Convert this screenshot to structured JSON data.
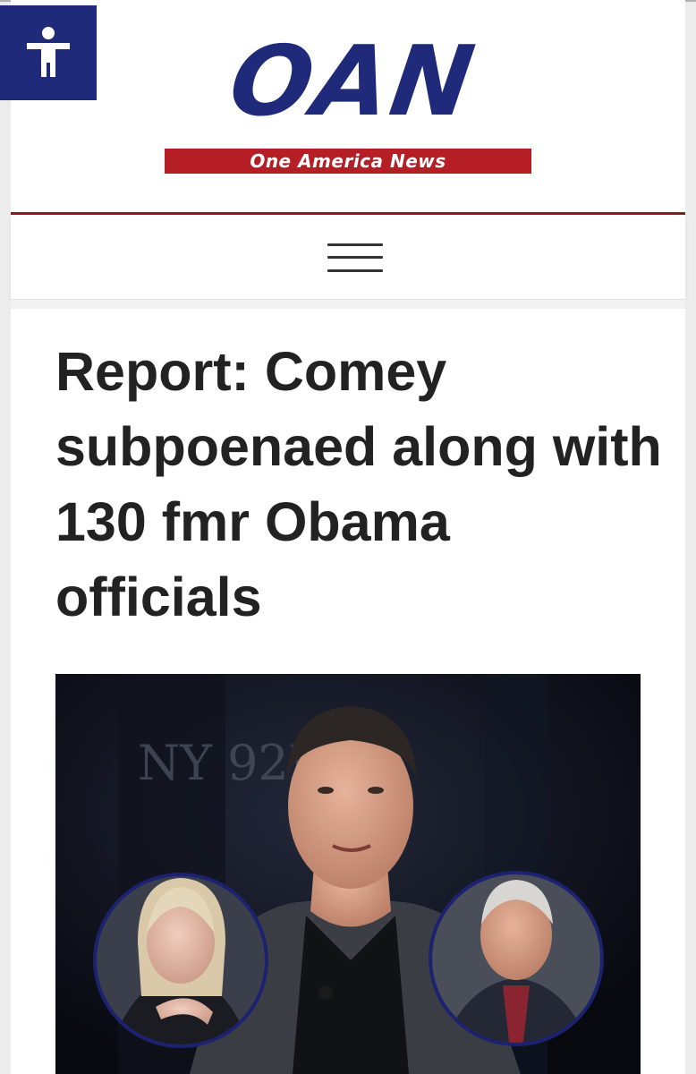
{
  "header": {
    "accessibility_label": "Accessibility",
    "logo_text": "OAN",
    "logo_tagline": "One America News"
  },
  "nav": {
    "menu_icon": "hamburger-menu-icon"
  },
  "article": {
    "headline": "Report: Comey subpoenaed along with 130 fmr Obama officials",
    "image_backdrop_text": "NY 92N"
  },
  "colors": {
    "brand_blue": "#1f2a7a",
    "brand_red": "#b51e24",
    "rule_red": "#8a1a1e",
    "headline_text": "#222222"
  }
}
